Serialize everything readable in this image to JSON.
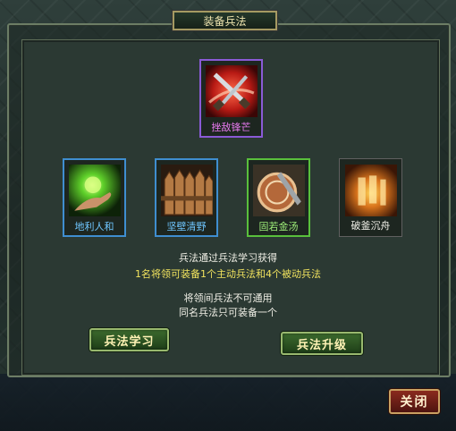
{
  "dialog": {
    "title": "装备兵法"
  },
  "featured_skill": {
    "label": "挫敌锋芒",
    "icon": "crossed-blades-icon"
  },
  "skills": [
    {
      "label": "地利人和",
      "icon": "green-energy-hand-icon"
    },
    {
      "label": "坚壁清野",
      "icon": "wooden-palisade-icon"
    },
    {
      "label": "固若金汤",
      "icon": "bronze-shield-icon"
    },
    {
      "label": "破釜沉舟",
      "icon": "fire-seal-icon"
    }
  ],
  "info": {
    "line1": "兵法通过兵法学习获得",
    "line2": "1名将领可装备1个主动兵法和4个被动兵法",
    "line3": "将领间兵法不可通用",
    "line4": "同名兵法只可装备一个"
  },
  "buttons": {
    "learn": "兵法学习",
    "upgrade": "兵法升级",
    "close": "关闭"
  },
  "colors": {
    "rare": "#8a5ad6",
    "blue": "#3f8ed0",
    "green": "#59c03c",
    "info_highlight": "#f1e35e"
  }
}
